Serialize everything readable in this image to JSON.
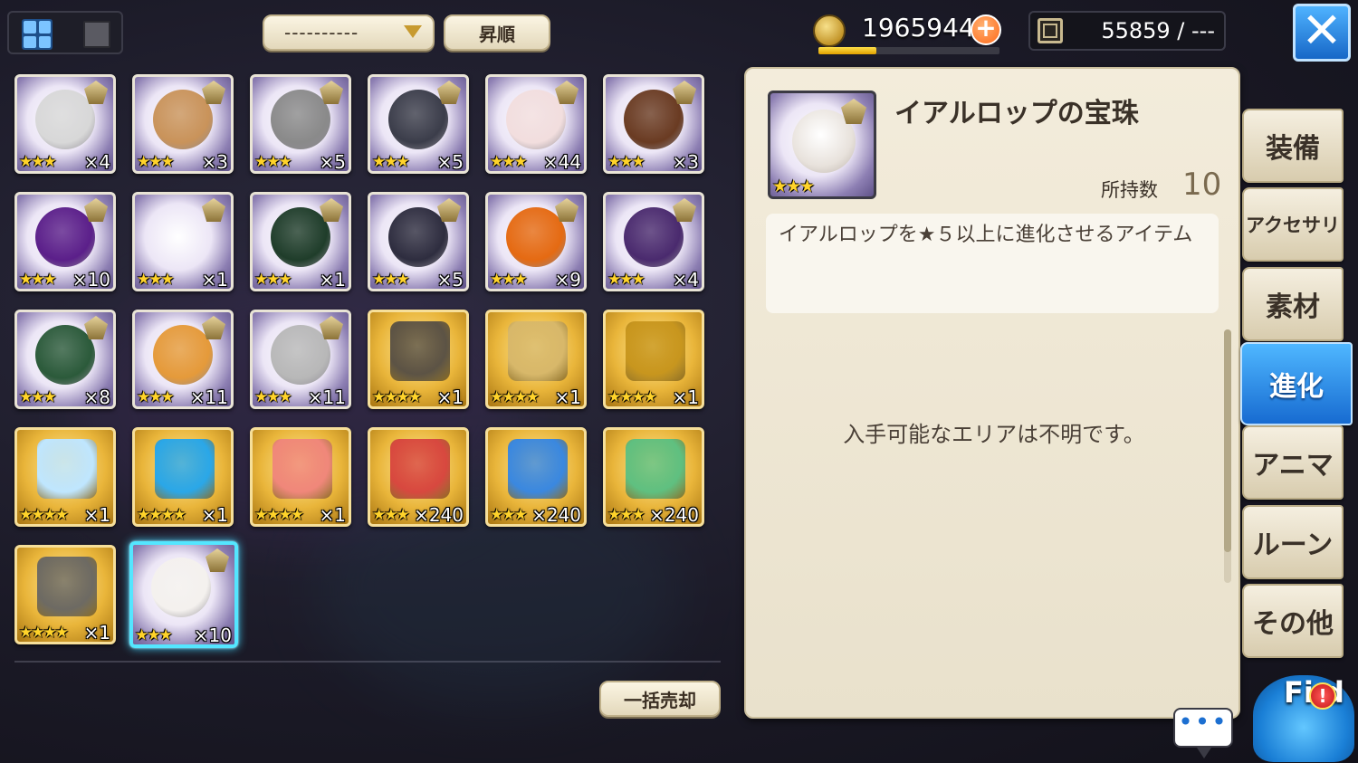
{
  "toolbar": {
    "sort_value": "----------",
    "order_label": "昇順",
    "coins": "1965944",
    "plus": "+",
    "coin_progress": 0.32,
    "collection": "55859 / ---",
    "close": "✕"
  },
  "grid": {
    "items": [
      {
        "icon": "cow-orb-icon",
        "type": "orb",
        "stars": "★★★",
        "qty": "×4",
        "color": "#d8d8d8"
      },
      {
        "icon": "hamster-orb-icon",
        "type": "orb",
        "stars": "★★★",
        "qty": "×3",
        "color": "#c9935a"
      },
      {
        "icon": "ghost-mask-orb-icon",
        "type": "orb",
        "stars": "★★★",
        "qty": "×5",
        "color": "#8a8a8a"
      },
      {
        "icon": "dark-skull-orb-icon",
        "type": "orb",
        "stars": "★★★",
        "qty": "×5",
        "color": "#3b3d4a"
      },
      {
        "icon": "white-bunny-orb-icon",
        "type": "orb",
        "stars": "★★★",
        "qty": "×44",
        "color": "#f2dede"
      },
      {
        "icon": "brown-ghost-orb-icon",
        "type": "orb",
        "stars": "★★★",
        "qty": "×3",
        "color": "#6a3b22"
      },
      {
        "icon": "purple-hood-orb-icon",
        "type": "orb",
        "stars": "★★★",
        "qty": "×10",
        "color": "#5b1f8a"
      },
      {
        "icon": "reaper-skull-orb-icon",
        "type": "orb",
        "stars": "★★★",
        "qty": "×1",
        "color": "#444"
      },
      {
        "icon": "green-reaper-orb-icon",
        "type": "orb",
        "stars": "★★★",
        "qty": "×1",
        "color": "#1f3d2a"
      },
      {
        "icon": "armored-reaper-orb-icon",
        "type": "orb",
        "stars": "★★★",
        "qty": "×5",
        "color": "#2e2d3f"
      },
      {
        "icon": "pumpkin-orb-icon",
        "type": "orb",
        "stars": "★★★",
        "qty": "×9",
        "color": "#e56a12"
      },
      {
        "icon": "witch-pumpkin-orb-icon",
        "type": "orb",
        "stars": "★★★",
        "qty": "×4",
        "color": "#4a2a6e"
      },
      {
        "icon": "green-cloak-orb-icon",
        "type": "orb",
        "stars": "★★★",
        "qty": "×8",
        "color": "#2b5a3a"
      },
      {
        "icon": "orange-pumpkin-orb-icon",
        "type": "orb",
        "stars": "★★★",
        "qty": "×11",
        "color": "#e59a3a"
      },
      {
        "icon": "white-mask-orb-icon",
        "type": "orb",
        "stars": "★★★",
        "qty": "×11",
        "color": "#b8b8b8"
      },
      {
        "icon": "knight-statue-icon",
        "type": "gold",
        "stars": "★★★★",
        "qty": "×1",
        "color": "#5c5345"
      },
      {
        "icon": "gold-bracelet-icon",
        "type": "gold",
        "stars": "★★★★",
        "qty": "×1",
        "color": "#d8b86a"
      },
      {
        "icon": "gold-ring-icon",
        "type": "gold",
        "stars": "★★★★",
        "qty": "×1",
        "color": "#c8961e"
      },
      {
        "icon": "frost-ornament-icon",
        "type": "gold",
        "stars": "★★★★",
        "qty": "×1",
        "color": "#bfe6ff"
      },
      {
        "icon": "blue-bowl-icon",
        "type": "gold",
        "stars": "★★★★",
        "qty": "×1",
        "color": "#2aa7e8"
      },
      {
        "icon": "peaches-icon",
        "type": "gold",
        "stars": "★★★★",
        "qty": "×1",
        "color": "#f0877a"
      },
      {
        "icon": "red-crystal-icon",
        "type": "gold",
        "stars": "★★★",
        "qty": "×240",
        "color": "#d8483f"
      },
      {
        "icon": "blue-crystal-icon",
        "type": "gold",
        "stars": "★★★",
        "qty": "×240",
        "color": "#3a88e0"
      },
      {
        "icon": "green-crystal-icon",
        "type": "gold",
        "stars": "★★★",
        "qty": "×240",
        "color": "#5fc080"
      },
      {
        "icon": "ore-rocks-icon",
        "type": "gold",
        "stars": "★★★★",
        "qty": "×1",
        "color": "#6d6a63"
      },
      {
        "icon": "rabbit-orb-icon",
        "type": "orb",
        "stars": "★★★",
        "qty": "×10",
        "color": "#f4f1ee",
        "selected": true
      }
    ],
    "sell_all": "一括売却"
  },
  "detail": {
    "title": "イアルロップの宝珠",
    "thumb_stars": "★★★",
    "owned_label": "所持数",
    "owned_value": "10",
    "description": "イアルロップを★５以上に進化させるアイテム",
    "area_text": "入手可能なエリアは不明です。"
  },
  "tabs": [
    {
      "label": "装備",
      "name": "tab-equipment"
    },
    {
      "label": "アクセサリ",
      "name": "tab-accessory"
    },
    {
      "label": "素材",
      "name": "tab-materials"
    },
    {
      "label": "進化",
      "name": "tab-evolution",
      "active": true
    },
    {
      "label": "アニマ",
      "name": "tab-anima"
    },
    {
      "label": "ルーン",
      "name": "tab-rune"
    },
    {
      "label": "その他",
      "name": "tab-other"
    }
  ],
  "footer": {
    "chat_dots": "•••",
    "field_label": "Fi d",
    "field_alert": "!"
  }
}
